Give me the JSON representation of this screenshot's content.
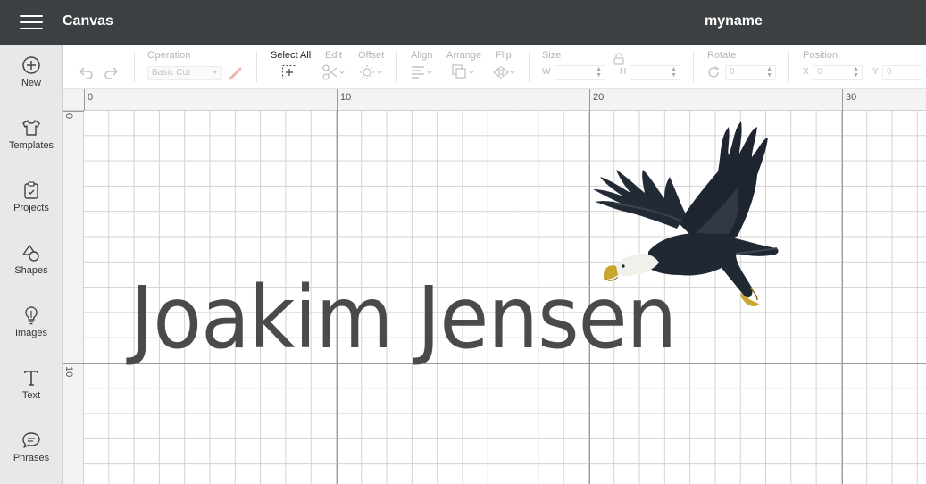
{
  "header": {
    "app_title": "Canvas",
    "project_name": "myname",
    "menu_icon": "hamburger-menu-icon"
  },
  "sidebar": {
    "items": [
      {
        "label": "New",
        "icon": "plus-circle-icon"
      },
      {
        "label": "Templates",
        "icon": "tshirt-icon"
      },
      {
        "label": "Projects",
        "icon": "clipboard-icon"
      },
      {
        "label": "Shapes",
        "icon": "shapes-icon"
      },
      {
        "label": "Images",
        "icon": "lightbulb-icon"
      },
      {
        "label": "Text",
        "icon": "text-t-icon"
      },
      {
        "label": "Phrases",
        "icon": "speech-bubble-icon"
      }
    ]
  },
  "toolbar": {
    "operation_label": "Operation",
    "operation_value": "Basic Cut",
    "select_all_label": "Select All",
    "edit_label": "Edit",
    "offset_label": "Offset",
    "align_label": "Align",
    "arrange_label": "Arrange",
    "flip_label": "Flip",
    "size_label": "Size",
    "size_w_letter": "W",
    "size_h_letter": "H",
    "rotate_label": "Rotate",
    "rotate_value": "0",
    "position_label": "Position",
    "position_x_letter": "X",
    "position_x_value": "0",
    "position_y_letter": "Y",
    "position_y_value": "0"
  },
  "ruler": {
    "top_labels": [
      "0",
      "10",
      "20",
      "30"
    ],
    "left_labels": [
      "0",
      "10"
    ]
  },
  "canvas": {
    "text_object": "Joakim Jensen",
    "image_object": "eagle-image"
  },
  "colors": {
    "header_bg": "#3c4043",
    "sidebar_bg": "#e8e8e8",
    "text_fill": "#4a4a4a"
  }
}
